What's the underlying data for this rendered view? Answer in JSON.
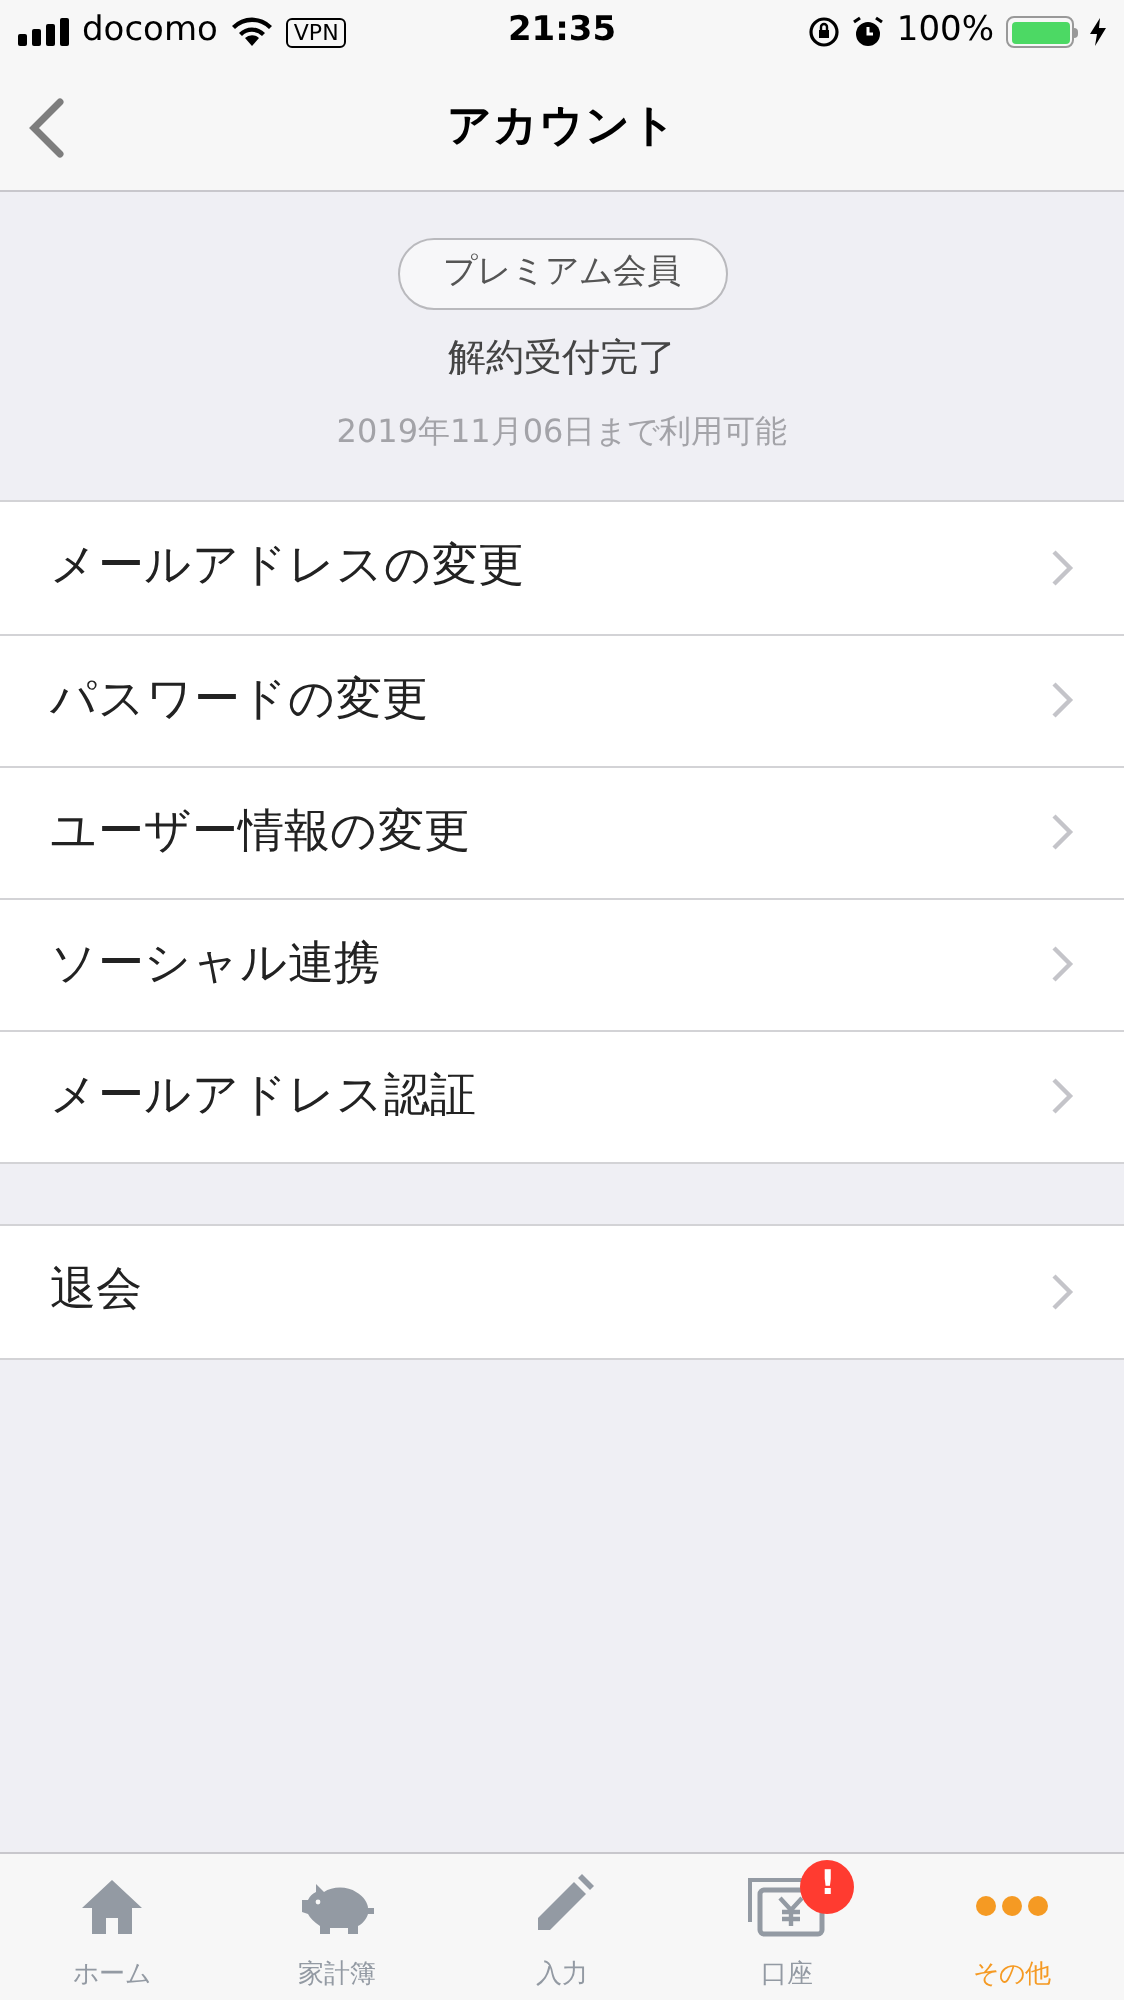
{
  "status_bar": {
    "carrier": "docomo",
    "vpn": "VPN",
    "time": "21:35",
    "battery": "100%"
  },
  "nav": {
    "title": "アカウント"
  },
  "membership": {
    "badge": "プレミアム会員",
    "status": "解約受付完了",
    "note": "2019年11月06日まで利用可能"
  },
  "menu_groups": [
    {
      "items": [
        {
          "label": "メールアドレスの変更"
        },
        {
          "label": "パスワードの変更"
        },
        {
          "label": "ユーザー情報の変更"
        },
        {
          "label": "ソーシャル連携"
        },
        {
          "label": "メールアドレス認証"
        }
      ]
    },
    {
      "items": [
        {
          "label": "退会"
        }
      ]
    }
  ],
  "tab_bar": [
    {
      "kind": "home",
      "label": "ホーム",
      "selected": false
    },
    {
      "kind": "piggy",
      "label": "家計簿",
      "selected": false
    },
    {
      "kind": "pencil",
      "label": "入力",
      "selected": false
    },
    {
      "kind": "account",
      "label": "口座",
      "selected": false,
      "badge": "!"
    },
    {
      "kind": "more",
      "label": "その他",
      "selected": true
    }
  ]
}
